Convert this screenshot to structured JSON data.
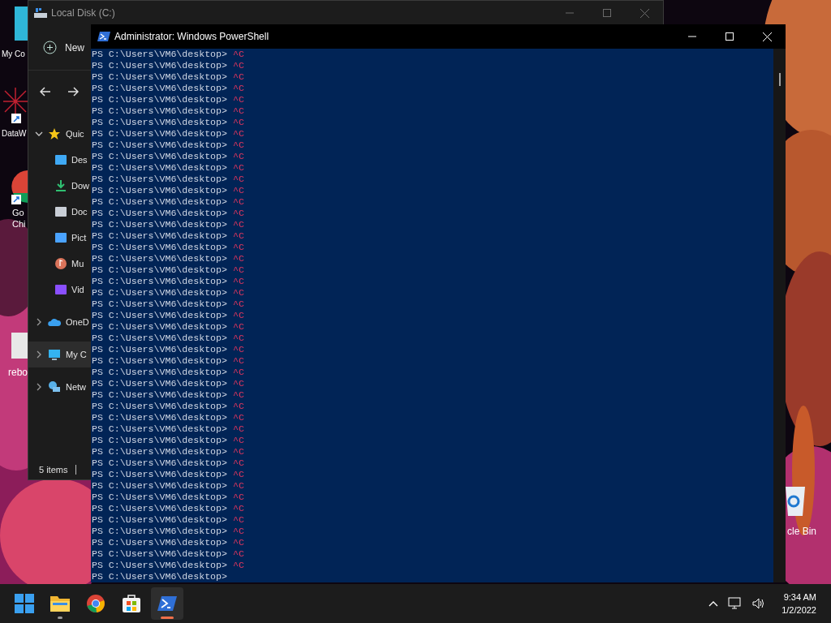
{
  "desktop_icons": [
    {
      "label": "My Co"
    },
    {
      "label": "DataW"
    },
    {
      "label": "Go Chi"
    },
    {
      "label": "rebo"
    },
    {
      "label": "cle Bin"
    }
  ],
  "explorer": {
    "title": "Local Disk (C:)",
    "new_button": "New",
    "nav": [
      {
        "label": "Quic",
        "expanded": true,
        "selected": false,
        "children": [
          {
            "label": "Des"
          },
          {
            "label": "Dow"
          },
          {
            "label": "Doc"
          },
          {
            "label": "Pict"
          },
          {
            "label": "Mu"
          },
          {
            "label": "Vid"
          }
        ]
      },
      {
        "label": "OneD",
        "expanded": false,
        "selected": false
      },
      {
        "label": "My C",
        "expanded": false,
        "selected": true
      },
      {
        "label": "Netw",
        "expanded": false,
        "selected": false
      }
    ],
    "status": "5 items"
  },
  "powershell": {
    "title": "Administrator: Windows PowerShell",
    "lines": [
      {
        "prompt": "PS C:\\Users\\VM6\\desktop>",
        "input": "^C"
      },
      {
        "prompt": "PS C:\\Users\\VM6\\desktop>",
        "input": "^C"
      },
      {
        "prompt": "PS C:\\Users\\VM6\\desktop>",
        "input": "^C"
      },
      {
        "prompt": "PS C:\\Users\\VM6\\desktop>",
        "input": "^C"
      },
      {
        "prompt": "PS C:\\Users\\VM6\\desktop>",
        "input": "^C"
      },
      {
        "prompt": "PS C:\\Users\\VM6\\desktop>",
        "input": "^C"
      },
      {
        "prompt": "PS C:\\Users\\VM6\\desktop>",
        "input": "^C"
      },
      {
        "prompt": "PS C:\\Users\\VM6\\desktop>",
        "input": "^C"
      },
      {
        "prompt": "PS C:\\Users\\VM6\\desktop>",
        "input": "^C"
      },
      {
        "prompt": "PS C:\\Users\\VM6\\desktop>",
        "input": "^C"
      },
      {
        "prompt": "PS C:\\Users\\VM6\\desktop>",
        "input": "^C"
      },
      {
        "prompt": "PS C:\\Users\\VM6\\desktop>",
        "input": "^C"
      },
      {
        "prompt": "PS C:\\Users\\VM6\\desktop>",
        "input": "^C"
      },
      {
        "prompt": "PS C:\\Users\\VM6\\desktop>",
        "input": "^C"
      },
      {
        "prompt": "PS C:\\Users\\VM6\\desktop>",
        "input": "^C"
      },
      {
        "prompt": "PS C:\\Users\\VM6\\desktop>",
        "input": "^C"
      },
      {
        "prompt": "PS C:\\Users\\VM6\\desktop>",
        "input": "^C"
      },
      {
        "prompt": "PS C:\\Users\\VM6\\desktop>",
        "input": "^C"
      },
      {
        "prompt": "PS C:\\Users\\VM6\\desktop>",
        "input": "^C"
      },
      {
        "prompt": "PS C:\\Users\\VM6\\desktop>",
        "input": "^C"
      },
      {
        "prompt": "PS C:\\Users\\VM6\\desktop>",
        "input": "^C"
      },
      {
        "prompt": "PS C:\\Users\\VM6\\desktop>",
        "input": "^C"
      },
      {
        "prompt": "PS C:\\Users\\VM6\\desktop>",
        "input": "^C"
      },
      {
        "prompt": "PS C:\\Users\\VM6\\desktop>",
        "input": "^C"
      },
      {
        "prompt": "PS C:\\Users\\VM6\\desktop>",
        "input": "^C"
      },
      {
        "prompt": "PS C:\\Users\\VM6\\desktop>",
        "input": "^C"
      },
      {
        "prompt": "PS C:\\Users\\VM6\\desktop>",
        "input": "^C"
      },
      {
        "prompt": "PS C:\\Users\\VM6\\desktop>",
        "input": "^C"
      },
      {
        "prompt": "PS C:\\Users\\VM6\\desktop>",
        "input": "^C"
      },
      {
        "prompt": "PS C:\\Users\\VM6\\desktop>",
        "input": "^C"
      },
      {
        "prompt": "PS C:\\Users\\VM6\\desktop>",
        "input": "^C"
      },
      {
        "prompt": "PS C:\\Users\\VM6\\desktop>",
        "input": "^C"
      },
      {
        "prompt": "PS C:\\Users\\VM6\\desktop>",
        "input": "^C"
      },
      {
        "prompt": "PS C:\\Users\\VM6\\desktop>",
        "input": "^C"
      },
      {
        "prompt": "PS C:\\Users\\VM6\\desktop>",
        "input": "^C"
      },
      {
        "prompt": "PS C:\\Users\\VM6\\desktop>",
        "input": "^C"
      },
      {
        "prompt": "PS C:\\Users\\VM6\\desktop>",
        "input": "^C"
      },
      {
        "prompt": "PS C:\\Users\\VM6\\desktop>",
        "input": "^C"
      },
      {
        "prompt": "PS C:\\Users\\VM6\\desktop>",
        "input": "^C"
      },
      {
        "prompt": "PS C:\\Users\\VM6\\desktop>",
        "input": "^C"
      },
      {
        "prompt": "PS C:\\Users\\VM6\\desktop>",
        "input": "^C"
      },
      {
        "prompt": "PS C:\\Users\\VM6\\desktop>",
        "input": "^C"
      },
      {
        "prompt": "PS C:\\Users\\VM6\\desktop>",
        "input": "^C"
      },
      {
        "prompt": "PS C:\\Users\\VM6\\desktop>",
        "input": "^C"
      },
      {
        "prompt": "PS C:\\Users\\VM6\\desktop>",
        "input": "^C"
      },
      {
        "prompt": "PS C:\\Users\\VM6\\desktop>",
        "input": "^C"
      },
      {
        "prompt": "PS C:\\Users\\VM6\\desktop>"
      }
    ]
  },
  "taskbar": {
    "apps": [
      {
        "running": false,
        "selected": false
      },
      {
        "running": true,
        "selected": false
      },
      {
        "running": false,
        "selected": false
      },
      {
        "running": false,
        "selected": false
      },
      {
        "running": true,
        "selected": true
      }
    ],
    "time": "9:34 AM",
    "date": "1/2/2022"
  }
}
